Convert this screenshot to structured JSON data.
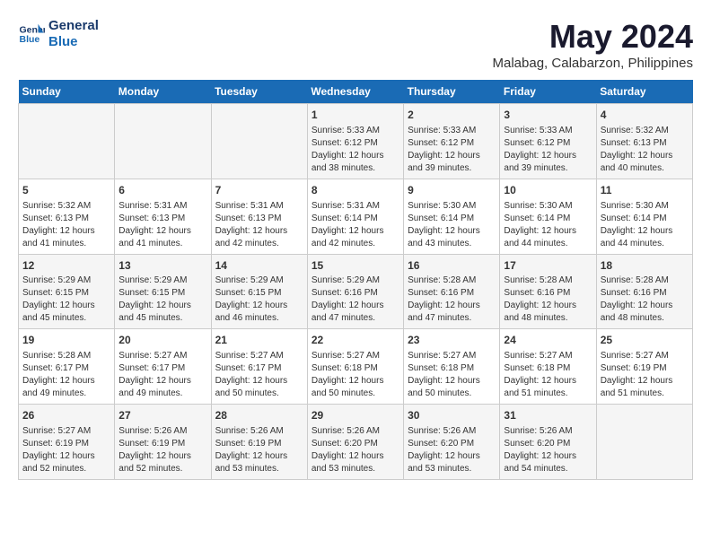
{
  "logo": {
    "line1": "General",
    "line2": "Blue"
  },
  "title": {
    "month_year": "May 2024",
    "location": "Malabag, Calabarzon, Philippines"
  },
  "header_days": [
    "Sunday",
    "Monday",
    "Tuesday",
    "Wednesday",
    "Thursday",
    "Friday",
    "Saturday"
  ],
  "weeks": [
    [
      {
        "day": "",
        "sunrise": "",
        "sunset": "",
        "daylight": ""
      },
      {
        "day": "",
        "sunrise": "",
        "sunset": "",
        "daylight": ""
      },
      {
        "day": "",
        "sunrise": "",
        "sunset": "",
        "daylight": ""
      },
      {
        "day": "1",
        "sunrise": "Sunrise: 5:33 AM",
        "sunset": "Sunset: 6:12 PM",
        "daylight": "Daylight: 12 hours and 38 minutes."
      },
      {
        "day": "2",
        "sunrise": "Sunrise: 5:33 AM",
        "sunset": "Sunset: 6:12 PM",
        "daylight": "Daylight: 12 hours and 39 minutes."
      },
      {
        "day": "3",
        "sunrise": "Sunrise: 5:33 AM",
        "sunset": "Sunset: 6:12 PM",
        "daylight": "Daylight: 12 hours and 39 minutes."
      },
      {
        "day": "4",
        "sunrise": "Sunrise: 5:32 AM",
        "sunset": "Sunset: 6:13 PM",
        "daylight": "Daylight: 12 hours and 40 minutes."
      }
    ],
    [
      {
        "day": "5",
        "sunrise": "Sunrise: 5:32 AM",
        "sunset": "Sunset: 6:13 PM",
        "daylight": "Daylight: 12 hours and 41 minutes."
      },
      {
        "day": "6",
        "sunrise": "Sunrise: 5:31 AM",
        "sunset": "Sunset: 6:13 PM",
        "daylight": "Daylight: 12 hours and 41 minutes."
      },
      {
        "day": "7",
        "sunrise": "Sunrise: 5:31 AM",
        "sunset": "Sunset: 6:13 PM",
        "daylight": "Daylight: 12 hours and 42 minutes."
      },
      {
        "day": "8",
        "sunrise": "Sunrise: 5:31 AM",
        "sunset": "Sunset: 6:14 PM",
        "daylight": "Daylight: 12 hours and 42 minutes."
      },
      {
        "day": "9",
        "sunrise": "Sunrise: 5:30 AM",
        "sunset": "Sunset: 6:14 PM",
        "daylight": "Daylight: 12 hours and 43 minutes."
      },
      {
        "day": "10",
        "sunrise": "Sunrise: 5:30 AM",
        "sunset": "Sunset: 6:14 PM",
        "daylight": "Daylight: 12 hours and 44 minutes."
      },
      {
        "day": "11",
        "sunrise": "Sunrise: 5:30 AM",
        "sunset": "Sunset: 6:14 PM",
        "daylight": "Daylight: 12 hours and 44 minutes."
      }
    ],
    [
      {
        "day": "12",
        "sunrise": "Sunrise: 5:29 AM",
        "sunset": "Sunset: 6:15 PM",
        "daylight": "Daylight: 12 hours and 45 minutes."
      },
      {
        "day": "13",
        "sunrise": "Sunrise: 5:29 AM",
        "sunset": "Sunset: 6:15 PM",
        "daylight": "Daylight: 12 hours and 45 minutes."
      },
      {
        "day": "14",
        "sunrise": "Sunrise: 5:29 AM",
        "sunset": "Sunset: 6:15 PM",
        "daylight": "Daylight: 12 hours and 46 minutes."
      },
      {
        "day": "15",
        "sunrise": "Sunrise: 5:29 AM",
        "sunset": "Sunset: 6:16 PM",
        "daylight": "Daylight: 12 hours and 47 minutes."
      },
      {
        "day": "16",
        "sunrise": "Sunrise: 5:28 AM",
        "sunset": "Sunset: 6:16 PM",
        "daylight": "Daylight: 12 hours and 47 minutes."
      },
      {
        "day": "17",
        "sunrise": "Sunrise: 5:28 AM",
        "sunset": "Sunset: 6:16 PM",
        "daylight": "Daylight: 12 hours and 48 minutes."
      },
      {
        "day": "18",
        "sunrise": "Sunrise: 5:28 AM",
        "sunset": "Sunset: 6:16 PM",
        "daylight": "Daylight: 12 hours and 48 minutes."
      }
    ],
    [
      {
        "day": "19",
        "sunrise": "Sunrise: 5:28 AM",
        "sunset": "Sunset: 6:17 PM",
        "daylight": "Daylight: 12 hours and 49 minutes."
      },
      {
        "day": "20",
        "sunrise": "Sunrise: 5:27 AM",
        "sunset": "Sunset: 6:17 PM",
        "daylight": "Daylight: 12 hours and 49 minutes."
      },
      {
        "day": "21",
        "sunrise": "Sunrise: 5:27 AM",
        "sunset": "Sunset: 6:17 PM",
        "daylight": "Daylight: 12 hours and 50 minutes."
      },
      {
        "day": "22",
        "sunrise": "Sunrise: 5:27 AM",
        "sunset": "Sunset: 6:18 PM",
        "daylight": "Daylight: 12 hours and 50 minutes."
      },
      {
        "day": "23",
        "sunrise": "Sunrise: 5:27 AM",
        "sunset": "Sunset: 6:18 PM",
        "daylight": "Daylight: 12 hours and 50 minutes."
      },
      {
        "day": "24",
        "sunrise": "Sunrise: 5:27 AM",
        "sunset": "Sunset: 6:18 PM",
        "daylight": "Daylight: 12 hours and 51 minutes."
      },
      {
        "day": "25",
        "sunrise": "Sunrise: 5:27 AM",
        "sunset": "Sunset: 6:19 PM",
        "daylight": "Daylight: 12 hours and 51 minutes."
      }
    ],
    [
      {
        "day": "26",
        "sunrise": "Sunrise: 5:27 AM",
        "sunset": "Sunset: 6:19 PM",
        "daylight": "Daylight: 12 hours and 52 minutes."
      },
      {
        "day": "27",
        "sunrise": "Sunrise: 5:26 AM",
        "sunset": "Sunset: 6:19 PM",
        "daylight": "Daylight: 12 hours and 52 minutes."
      },
      {
        "day": "28",
        "sunrise": "Sunrise: 5:26 AM",
        "sunset": "Sunset: 6:19 PM",
        "daylight": "Daylight: 12 hours and 53 minutes."
      },
      {
        "day": "29",
        "sunrise": "Sunrise: 5:26 AM",
        "sunset": "Sunset: 6:20 PM",
        "daylight": "Daylight: 12 hours and 53 minutes."
      },
      {
        "day": "30",
        "sunrise": "Sunrise: 5:26 AM",
        "sunset": "Sunset: 6:20 PM",
        "daylight": "Daylight: 12 hours and 53 minutes."
      },
      {
        "day": "31",
        "sunrise": "Sunrise: 5:26 AM",
        "sunset": "Sunset: 6:20 PM",
        "daylight": "Daylight: 12 hours and 54 minutes."
      },
      {
        "day": "",
        "sunrise": "",
        "sunset": "",
        "daylight": ""
      }
    ]
  ]
}
